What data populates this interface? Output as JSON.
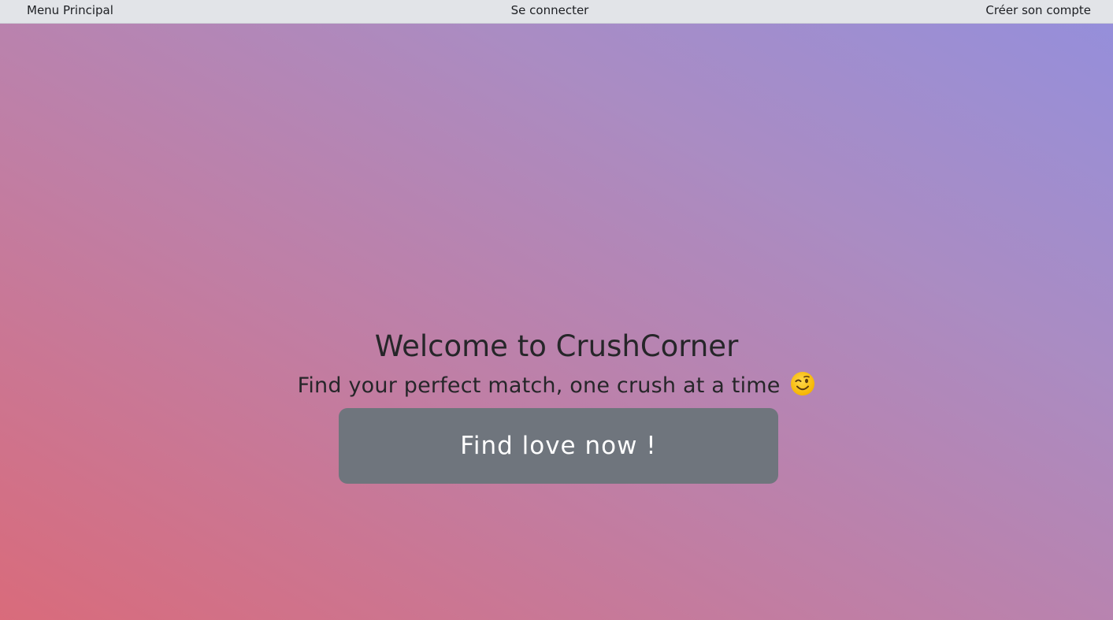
{
  "nav": {
    "menu_label": "Menu Principal",
    "login_label": "Se connecter",
    "signup_label": "Créer son compte"
  },
  "hero": {
    "title": "Welcome to CrushCorner",
    "subtitle": "Find your perfect match, one crush at a time",
    "subtitle_emoji": "winking-face-emoji",
    "cta_label": "Find love now !"
  },
  "colors": {
    "nav_bg": "#e2e4e8",
    "text": "#262629",
    "button_bg": "#6f757d",
    "button_text": "#ffffff",
    "gradient_start": "#d96b7b",
    "gradient_end": "#948fdc"
  }
}
